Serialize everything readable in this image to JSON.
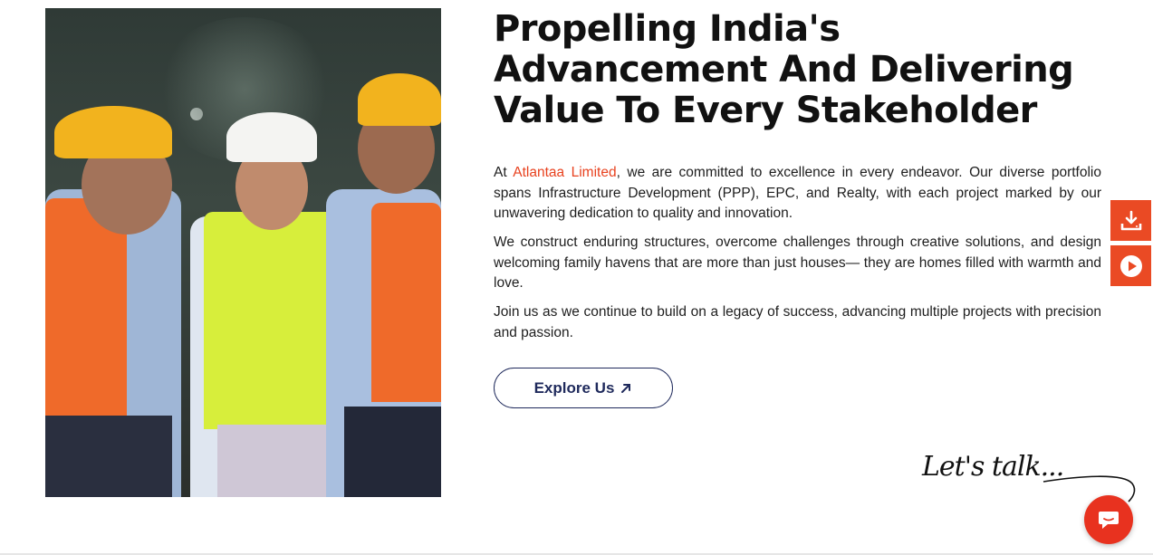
{
  "hero": {
    "title": "Propelling India's Advancement And Delivering Value To Every Stakeholder",
    "image_alt": "Three construction professionals in hard hats and safety vests"
  },
  "about": {
    "p1_prefix": "At ",
    "company_name": "Atlantaa Limited",
    "p1_suffix": ", we are committed to excellence in every endeavor. Our diverse portfolio spans Infrastructure Development (PPP), EPC, and Realty, with each project marked by our unwavering dedication to quality and innovation.",
    "p2": "We construct enduring structures, overcome challenges through creative solutions, and design welcoming family havens that are more than just houses— they are homes filled with warmth and love.",
    "p3": "Join us as we continue to build on a legacy of success, advancing multiple projects with precision and passion."
  },
  "cta": {
    "explore_label": "Explore Us"
  },
  "side_actions": {
    "download_icon": "download-icon",
    "play_icon": "play-icon"
  },
  "chat": {
    "prompt": "Let's talk..."
  },
  "colors": {
    "accent": "#ea4a24",
    "navy": "#1f2a5c",
    "text": "#141414"
  }
}
